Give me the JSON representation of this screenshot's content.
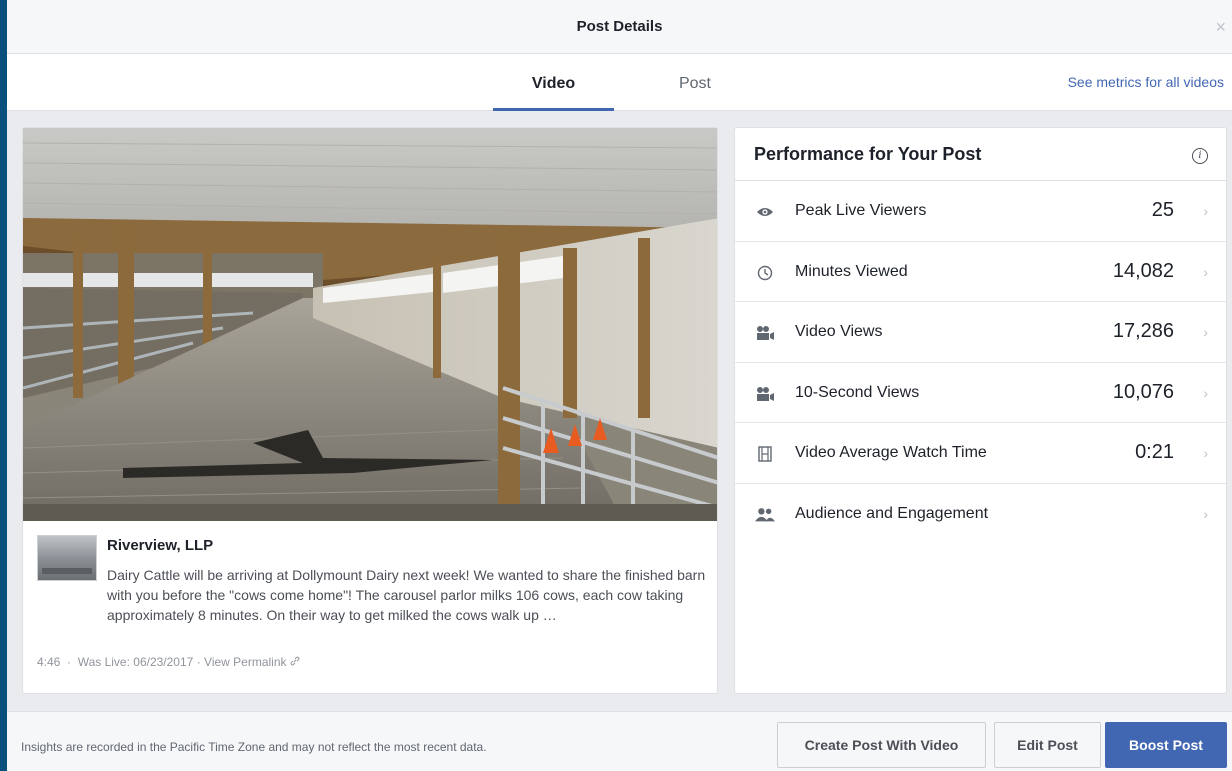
{
  "dialog": {
    "title": "Post Details",
    "close_icon": "close-icon",
    "close_glyph": "×"
  },
  "tabs": {
    "items": [
      {
        "label": "Video",
        "active": true
      },
      {
        "label": "Post",
        "active": false
      }
    ],
    "all_videos_link": "See metrics for all videos"
  },
  "post": {
    "author": "Riverview, LLP",
    "text": "Dairy Cattle will be arriving at Dollymount Dairy next week! We wanted to share the finished barn with you before the \"cows come home\"! The carousel parlor milks 106 cows, each cow taking approximately 8 minutes. On their way to get milked the cows walk up …",
    "duration": "4:46",
    "separator": "·",
    "was_live": "Was Live: 06/23/2017",
    "permalink": "View Permalink",
    "permalink_icon": "link-icon"
  },
  "performance": {
    "title": "Performance for Your Post",
    "info_icon": "info-icon",
    "metrics": [
      {
        "icon": "eye-icon",
        "label": "Peak Live Viewers",
        "value": "25"
      },
      {
        "icon": "clock-icon",
        "label": "Minutes Viewed",
        "value": "14,082"
      },
      {
        "icon": "video-camera-icon",
        "label": "Video Views",
        "value": "17,286"
      },
      {
        "icon": "video-camera-icon",
        "label": "10-Second Views",
        "value": "10,076"
      },
      {
        "icon": "film-icon",
        "label": "Video Average Watch Time",
        "value": "0:21"
      },
      {
        "icon": "people-icon",
        "label": "Audience and Engagement",
        "value": ""
      }
    ]
  },
  "footer": {
    "note": "Insights are recorded in the Pacific Time Zone and may not reflect the most recent data.",
    "create_label": "Create Post With Video",
    "edit_label": "Edit Post",
    "boost_label": "Boost Post"
  },
  "colors": {
    "accent": "#4267b2",
    "background": "#0b4f7d",
    "panel": "#e9ebee"
  }
}
